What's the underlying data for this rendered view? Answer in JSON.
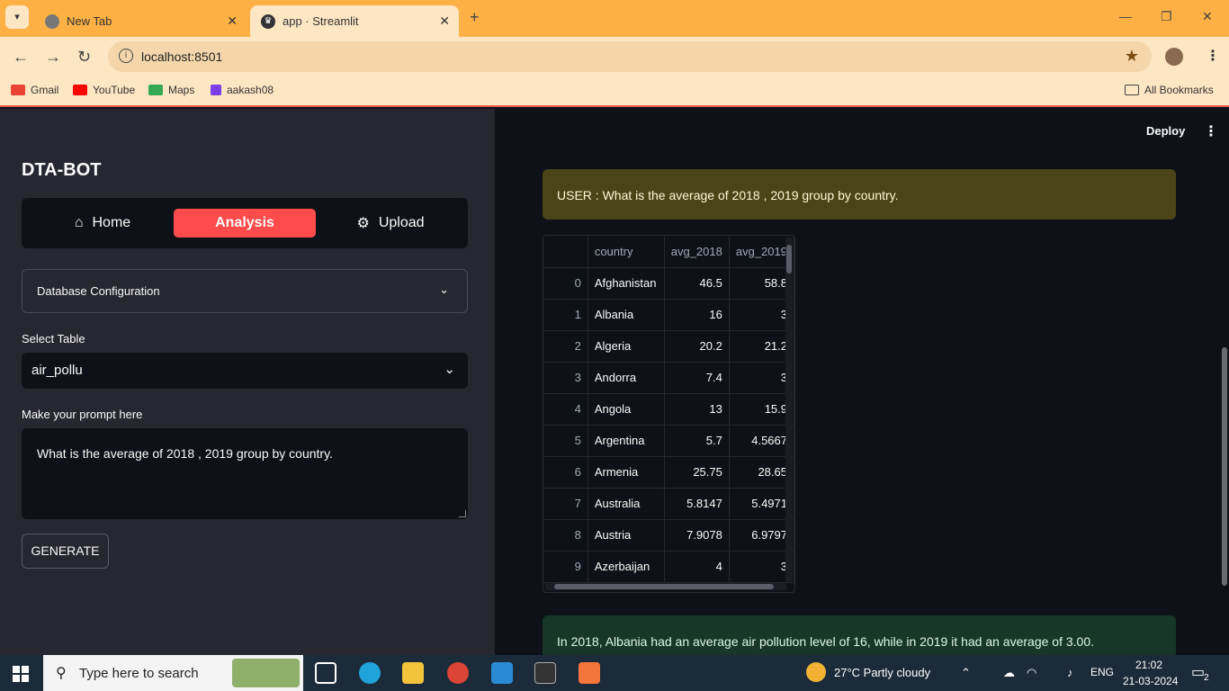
{
  "browser": {
    "tabs": [
      {
        "title": "New Tab"
      },
      {
        "title": "app · Streamlit"
      }
    ],
    "url": "localhost:8501",
    "bookmarks": [
      "Gmail",
      "YouTube",
      "Maps",
      "aakash08"
    ],
    "all_bookmarks": "All Bookmarks"
  },
  "sidebar": {
    "app_title": "DTA-BOT",
    "nav": {
      "home": "Home",
      "analysis": "Analysis",
      "upload": "Upload"
    },
    "db_config": "Database Configuration",
    "select_table_label": "Select Table",
    "select_table_value": "air_pollu",
    "prompt_label": "Make your prompt here",
    "prompt_value": "What is the average of 2018 , 2019 group by country.",
    "generate_label": "GENERATE"
  },
  "main": {
    "deploy_label": "Deploy",
    "user_message": "USER : What is the average of 2018 , 2019 group by country.",
    "dataframe": {
      "columns": [
        "",
        "country",
        "avg_2018",
        "avg_2019"
      ],
      "rows": [
        [
          "0",
          "Afghanistan",
          "46.5",
          "58.8"
        ],
        [
          "1",
          "Albania",
          "16",
          "3"
        ],
        [
          "2",
          "Algeria",
          "20.2",
          "21.2"
        ],
        [
          "3",
          "Andorra",
          "7.4",
          "3"
        ],
        [
          "4",
          "Angola",
          "13",
          "15.9"
        ],
        [
          "5",
          "Argentina",
          "5.7",
          "4.5667"
        ],
        [
          "6",
          "Armenia",
          "25.75",
          "28.65"
        ],
        [
          "7",
          "Australia",
          "5.8147",
          "5.4971"
        ],
        [
          "8",
          "Austria",
          "7.9078",
          "6.9797"
        ],
        [
          "9",
          "Azerbaijan",
          "4",
          "3"
        ]
      ]
    },
    "assistant_message": "In 2018, Albania had an average air pollution level of 16, while in 2019 it had an average of 3.00."
  },
  "taskbar": {
    "search_placeholder": "Type here to search",
    "weather": "27°C  Partly cloudy",
    "lang": "ENG",
    "time": "21:02",
    "date": "21-03-2024",
    "notifications": "2"
  }
}
